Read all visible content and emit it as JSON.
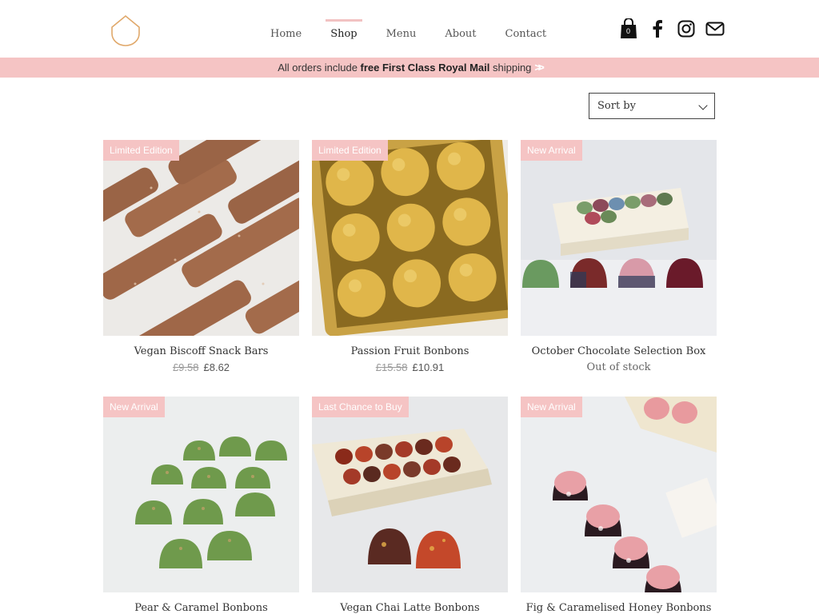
{
  "nav": {
    "items": [
      {
        "label": "Home",
        "active": false
      },
      {
        "label": "Shop",
        "active": true
      },
      {
        "label": "Menu",
        "active": false
      },
      {
        "label": "About",
        "active": false
      },
      {
        "label": "Contact",
        "active": false
      }
    ],
    "cart_count": "0",
    "icons": [
      "cart-icon",
      "facebook-icon",
      "instagram-icon",
      "mail-icon"
    ]
  },
  "banner": {
    "prefix": "All orders include ",
    "highlight": "free First Class Royal Mail",
    "suffix": " shipping"
  },
  "sort": {
    "label": "Sort by"
  },
  "colors": {
    "accent": "#f5c4c4",
    "ribbon_text": "#ffffff",
    "text": "#333333"
  },
  "products": [
    {
      "ribbon": "Limited Edition",
      "name": "Vegan Biscoff Snack Bars",
      "old_price": "£9.58",
      "price": "£8.62"
    },
    {
      "ribbon": "Limited Edition",
      "name": "Passion Fruit Bonbons",
      "old_price": "£15.58",
      "price": "£10.91"
    },
    {
      "ribbon": "New Arrival",
      "name": "October Chocolate Selection Box",
      "status": "Out of stock"
    },
    {
      "ribbon": "New Arrival",
      "name": "Pear & Caramel Bonbons"
    },
    {
      "ribbon": "Last Chance to Buy",
      "name": "Vegan Chai Latte Bonbons"
    },
    {
      "ribbon": "New Arrival",
      "name": "Fig & Caramelised Honey Bonbons"
    }
  ]
}
